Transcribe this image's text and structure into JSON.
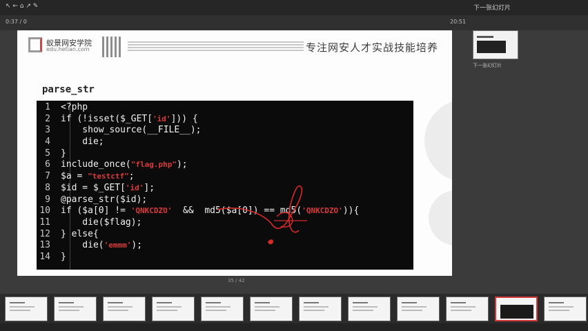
{
  "top_bar": {
    "items": [
      "↖ ← ⌂ ↗ ✎"
    ],
    "right_text": "下一张幻灯片"
  },
  "sub_bar": {
    "left_time": "0:37 / 0",
    "right_time": "20:51"
  },
  "slide": {
    "logo_name": "蚁景网安学院",
    "logo_url": "edu.hetian.com",
    "slogan": "专注网安人才实战技能培养",
    "title": "parse_str",
    "code_lines": [
      {
        "n": "1",
        "parts": [
          {
            "t": "<?php"
          }
        ]
      },
      {
        "n": "2",
        "parts": [
          {
            "t": "if (!isset($_GET["
          },
          {
            "t": "'id'",
            "s": true
          },
          {
            "t": "])) {"
          }
        ]
      },
      {
        "n": "3",
        "parts": [
          {
            "t": "    show_source(__FILE__);"
          }
        ]
      },
      {
        "n": "4",
        "parts": [
          {
            "t": "    die;"
          }
        ]
      },
      {
        "n": "5",
        "parts": [
          {
            "t": "}"
          }
        ]
      },
      {
        "n": "6",
        "parts": [
          {
            "t": "include_once("
          },
          {
            "t": "\"flag.php\"",
            "s": true
          },
          {
            "t": ");"
          }
        ]
      },
      {
        "n": "7",
        "parts": [
          {
            "t": "$a = "
          },
          {
            "t": "\"testctf\"",
            "s": true
          },
          {
            "t": ";"
          }
        ]
      },
      {
        "n": "8",
        "parts": [
          {
            "t": "$id = $_GET["
          },
          {
            "t": "'id'",
            "s": true
          },
          {
            "t": "];"
          }
        ]
      },
      {
        "n": "9",
        "parts": [
          {
            "t": "@parse_str($id);"
          }
        ]
      },
      {
        "n": "10",
        "parts": [
          {
            "t": "if ($a[0] != "
          },
          {
            "t": "'QNKCDZO'",
            "s": true
          },
          {
            "t": "  &&  md5($a[0]) == md5("
          },
          {
            "t": "'QNKCDZO'",
            "s": true
          },
          {
            "t": ")){"
          }
        ]
      },
      {
        "n": "11",
        "parts": [
          {
            "t": "    die($flag);"
          }
        ]
      },
      {
        "n": "12",
        "parts": [
          {
            "t": "} else{"
          }
        ]
      },
      {
        "n": "13",
        "parts": [
          {
            "t": "    die("
          },
          {
            "t": "'emmm'",
            "s": true
          },
          {
            "t": ");"
          }
        ]
      },
      {
        "n": "14",
        "parts": [
          {
            "t": "}"
          }
        ]
      }
    ],
    "page_indicator": "35 / 42"
  },
  "sidebar": {
    "next_label": "下一张幻灯片"
  },
  "thumbnails": {
    "count": 12,
    "active_index": 10
  },
  "colors": {
    "string_red": "#d93b3b",
    "annotation_red": "#d42a2a",
    "code_bg": "#0b0b0b"
  }
}
